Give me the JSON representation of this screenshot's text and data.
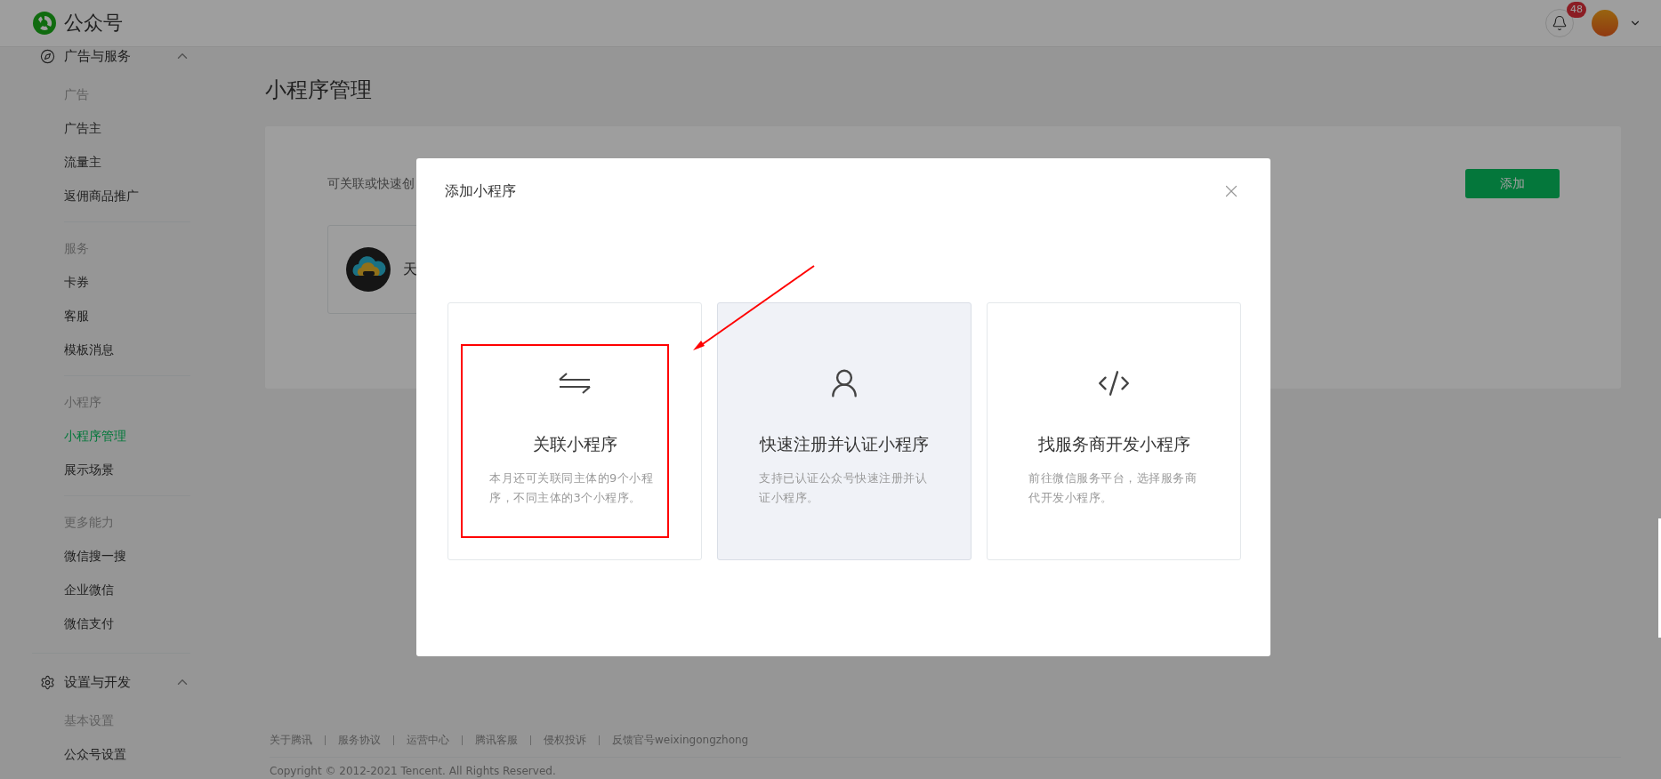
{
  "header": {
    "logo_text": "公众号",
    "notification_badge": "48"
  },
  "sidebar": {
    "groups": [
      {
        "title": "广告与服务",
        "expanded": true,
        "sections": [
          {
            "heading": "广告",
            "items": [
              {
                "label": "广告主",
                "selected": false
              },
              {
                "label": "流量主",
                "selected": false
              },
              {
                "label": "返佣商品推广",
                "selected": false
              }
            ]
          },
          {
            "heading": "服务",
            "items": [
              {
                "label": "卡券",
                "selected": false
              },
              {
                "label": "客服",
                "selected": false
              },
              {
                "label": "模板消息",
                "selected": false
              }
            ]
          },
          {
            "heading": "小程序",
            "items": [
              {
                "label": "小程序管理",
                "selected": true
              },
              {
                "label": "展示场景",
                "selected": false
              }
            ]
          },
          {
            "heading": "更多能力",
            "items": [
              {
                "label": "微信搜一搜",
                "selected": false
              },
              {
                "label": "企业微信",
                "selected": false
              },
              {
                "label": "微信支付",
                "selected": false
              }
            ]
          }
        ]
      },
      {
        "title": "设置与开发",
        "expanded": true,
        "sections": [
          {
            "heading": "基本设置",
            "items": [
              {
                "label": "公众号设置",
                "selected": false
              }
            ]
          }
        ]
      }
    ]
  },
  "main": {
    "title": "小程序管理",
    "card": {
      "description": "可关联或快速创",
      "add_button": "添加",
      "mini_apps": [
        {
          "name": "天"
        }
      ]
    }
  },
  "dialog": {
    "title": "添加小程序",
    "options": [
      {
        "kind": "link",
        "title": "关联小程序",
        "description": "本月还可关联同主体的9个小程序，不同主体的3个小程序。",
        "hovered": false
      },
      {
        "kind": "register",
        "title": "快速注册并认证小程序",
        "description": "支持已认证公众号快速注册并认证小程序。",
        "hovered": true
      },
      {
        "kind": "developer",
        "title": "找服务商开发小程序",
        "description": "前往微信服务平台，选择服务商代开发小程序。",
        "hovered": false
      }
    ]
  },
  "footer": {
    "links": [
      "关于腾讯",
      "服务协议",
      "运营中心",
      "腾讯客服",
      "侵权投诉",
      "反馈官号weixingongzhong"
    ],
    "copyright": "Copyright © 2012-2021 Tencent. All Rights Reserved."
  }
}
